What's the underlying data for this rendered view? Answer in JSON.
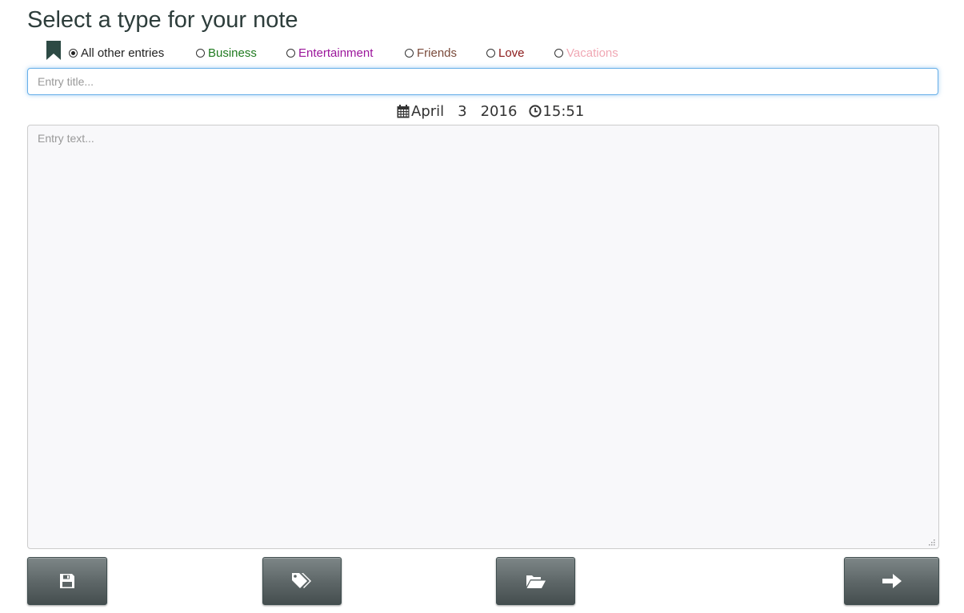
{
  "header": {
    "title": "Select a type for your note"
  },
  "note_types": [
    {
      "label": "All other entries",
      "color": "#222222",
      "checked": true
    },
    {
      "label": "Business",
      "color": "#1f7a1f",
      "checked": false
    },
    {
      "label": "Entertainment",
      "color": "#9b169b",
      "checked": false
    },
    {
      "label": "Friends",
      "color": "#7a4a3a",
      "checked": false
    },
    {
      "label": "Love",
      "color": "#8b1a1a",
      "checked": false
    },
    {
      "label": "Vacations",
      "color": "#f0a8b4",
      "checked": false
    }
  ],
  "entry": {
    "title_placeholder": "Entry title...",
    "text_placeholder": "Entry text..."
  },
  "datetime": {
    "month": "April",
    "day": "3",
    "year": "2016",
    "time": "15:51"
  },
  "icons": {
    "bookmark": "bookmark-icon",
    "calendar": "calendar-icon",
    "clock": "clock-icon",
    "save": "floppy-disk-icon",
    "tags": "tags-icon",
    "open": "open-folder-icon",
    "next": "arrow-right-icon"
  },
  "colors": {
    "accent": "#2d3d3b",
    "button": "#5c6566",
    "focus": "#66afe9"
  }
}
